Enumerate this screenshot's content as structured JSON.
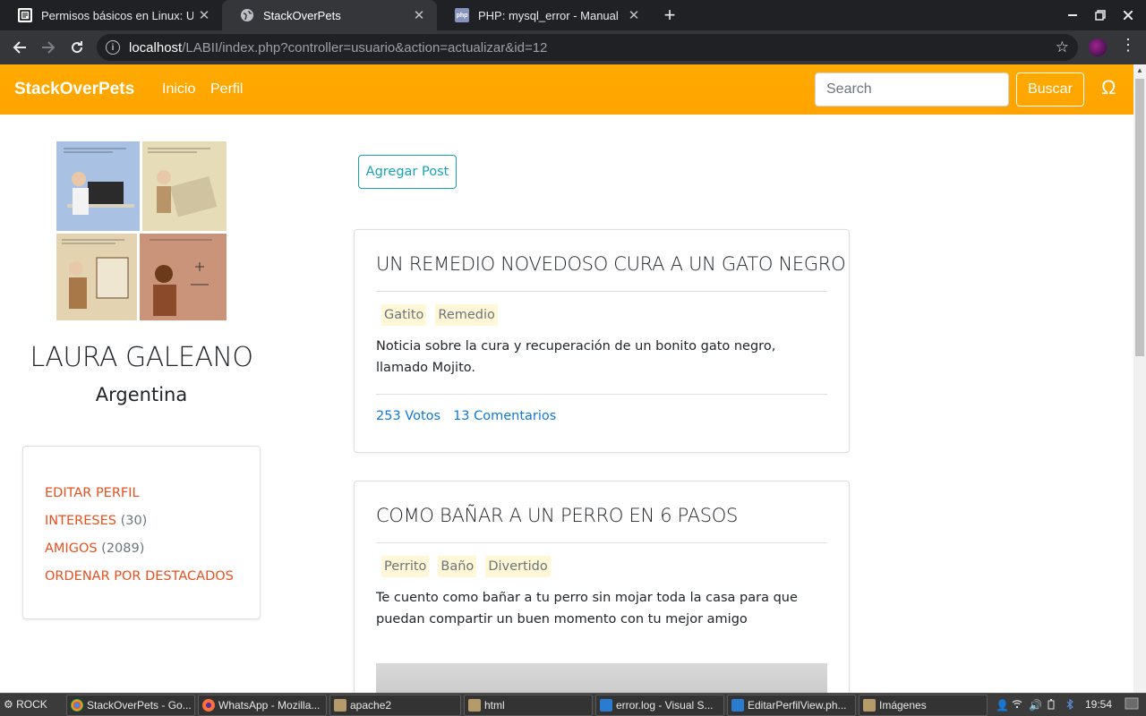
{
  "browser": {
    "tabs": [
      {
        "title": "Permisos básicos en Linux: U",
        "favicon": "document-icon",
        "active": false
      },
      {
        "title": "StackOverPets",
        "favicon": "globe-icon",
        "active": true
      },
      {
        "title": "PHP: mysql_error - Manual",
        "favicon": "php-icon",
        "active": false
      }
    ],
    "url_host": "localhost",
    "url_path": "/LABII/index.php?controller=usuario&action=actualizar&id=12"
  },
  "navbar": {
    "brand": "StackOverPets",
    "links": [
      "Inicio",
      "Perfil"
    ],
    "search_placeholder": "Search",
    "search_button": "Buscar",
    "user_icon": "Ω",
    "accent_color": "#ffa500"
  },
  "profile": {
    "name": "LAURA GALEANO",
    "country": "Argentina",
    "menu": {
      "edit": "EDITAR PERFIL",
      "interests_label": "INTERESES",
      "interests_count": "(30)",
      "friends_label": "AMIGOS",
      "friends_count": "(2089)",
      "sort": "ORDENAR POR DESTACADOS"
    }
  },
  "main": {
    "add_post": "Agregar Post",
    "posts": [
      {
        "title": "UN REMEDIO NOVEDOSO CURA A UN GATO NEGRO",
        "tags": [
          "Gatito",
          "Remedio"
        ],
        "description": "Noticia sobre la cura y recuperación de un bonito gato negro, llamado Mojito.",
        "votes": "253 Votos",
        "comments": "13 Comentarios"
      },
      {
        "title": "COMO BAÑAR A UN PERRO EN 6 PASOS",
        "tags": [
          "Perrito",
          "Baño",
          "Divertido"
        ],
        "description": "Te cuento como bañar a tu perro sin mojar toda la casa para que puedan compartir un buen momento con tu mejor amigo"
      }
    ]
  },
  "taskbar": {
    "start": "ROCK",
    "items": [
      "StackOverPets - Go...",
      "WhatsApp - Mozilla...",
      "apache2",
      "html",
      "error.log - Visual S...",
      "EditarPerfilView.ph...",
      "Imágenes"
    ],
    "clock": "19:54"
  }
}
